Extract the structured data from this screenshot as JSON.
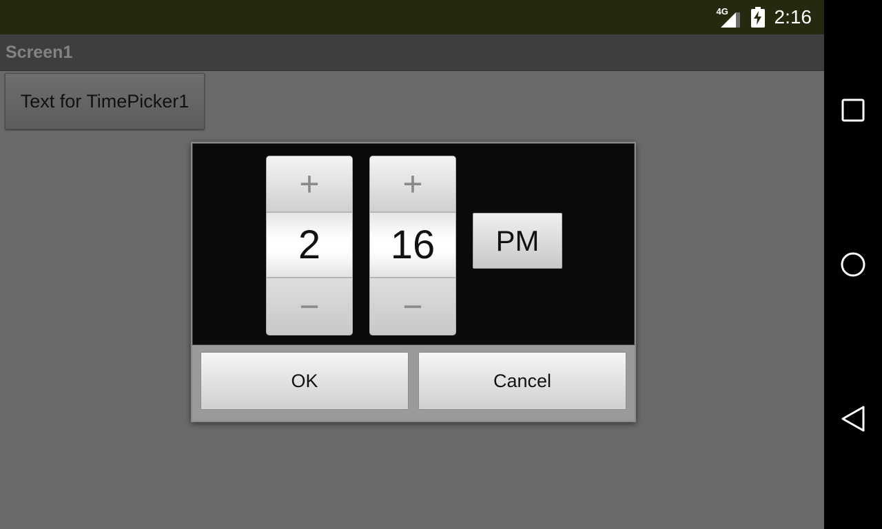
{
  "status_bar": {
    "network_label": "4G",
    "signal_icon": "signal-icon",
    "battery_icon": "battery-charging-icon",
    "time": "2:16"
  },
  "title_bar": {
    "title": "Screen1"
  },
  "content": {
    "timepicker_button_label": "Text for TimePicker1"
  },
  "dialog": {
    "hour": {
      "increment_symbol": "+",
      "value": "2",
      "decrement_symbol": "−"
    },
    "minute": {
      "increment_symbol": "+",
      "value": "16",
      "decrement_symbol": "−"
    },
    "ampm_label": "PM",
    "ok_label": "OK",
    "cancel_label": "Cancel"
  },
  "nav_bar": {
    "recents_icon": "square-icon",
    "home_icon": "circle-icon",
    "back_icon": "triangle-back-icon"
  },
  "colors": {
    "status_bar_bg": "#232a0f",
    "title_bar_bg": "#3e3e3e",
    "content_bg": "#6a6a6a",
    "dialog_picker_bg": "#0a0a0a"
  }
}
